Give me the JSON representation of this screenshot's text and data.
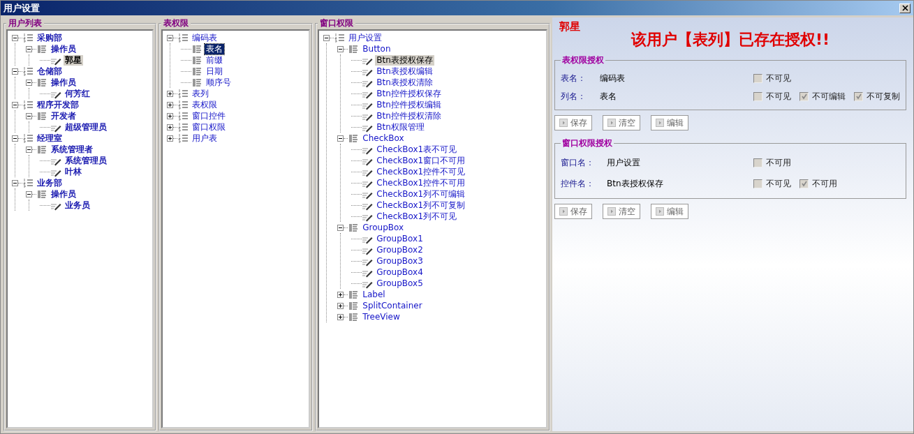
{
  "window": {
    "title": "用户设置"
  },
  "trees": [
    {
      "title": "用户列表",
      "focused": false,
      "bold": true,
      "nodes": [
        {
          "label": "采购部",
          "kind": "category",
          "expanded": true,
          "selected": false,
          "children": [
            {
              "label": "操作员",
              "kind": "list",
              "expanded": true,
              "selected": false,
              "children": [
                {
                  "label": "郭星",
                  "kind": "item",
                  "selected": true
                }
              ]
            }
          ]
        },
        {
          "label": "仓储部",
          "kind": "category",
          "expanded": true,
          "selected": false,
          "children": [
            {
              "label": "操作员",
              "kind": "list",
              "expanded": true,
              "selected": false,
              "children": [
                {
                  "label": "何芳红",
                  "kind": "item",
                  "selected": false
                }
              ]
            }
          ]
        },
        {
          "label": "程序开发部",
          "kind": "category",
          "expanded": true,
          "selected": false,
          "children": [
            {
              "label": "开发者",
              "kind": "list",
              "expanded": true,
              "selected": false,
              "children": [
                {
                  "label": "超级管理员",
                  "kind": "item",
                  "selected": false
                }
              ]
            }
          ]
        },
        {
          "label": "经理室",
          "kind": "category",
          "expanded": true,
          "selected": false,
          "children": [
            {
              "label": "系统管理者",
              "kind": "list",
              "expanded": true,
              "selected": false,
              "children": [
                {
                  "label": "系统管理员",
                  "kind": "item",
                  "selected": false
                },
                {
                  "label": "叶林",
                  "kind": "item",
                  "selected": false
                }
              ]
            }
          ]
        },
        {
          "label": "业务部",
          "kind": "category",
          "expanded": true,
          "selected": false,
          "children": [
            {
              "label": "操作员",
              "kind": "list",
              "expanded": true,
              "selected": false,
              "children": [
                {
                  "label": "业务员",
                  "kind": "item",
                  "selected": false
                }
              ]
            }
          ]
        }
      ]
    },
    {
      "title": "表权限",
      "focused": true,
      "bold": false,
      "nodes": [
        {
          "label": "编码表",
          "kind": "category",
          "expanded": true,
          "selected": false,
          "children": [
            {
              "label": "表名",
              "kind": "list",
              "selected": true
            },
            {
              "label": "前缀",
              "kind": "list",
              "selected": false
            },
            {
              "label": "日期",
              "kind": "list",
              "selected": false
            },
            {
              "label": "顺序号",
              "kind": "list",
              "selected": false
            }
          ]
        },
        {
          "label": "表列",
          "kind": "category",
          "expanded": false,
          "selected": false
        },
        {
          "label": "表权限",
          "kind": "category",
          "expanded": false,
          "selected": false
        },
        {
          "label": "窗口控件",
          "kind": "category",
          "expanded": false,
          "selected": false
        },
        {
          "label": "窗口权限",
          "kind": "category",
          "expanded": false,
          "selected": false
        },
        {
          "label": "用户表",
          "kind": "category",
          "expanded": false,
          "selected": false
        }
      ]
    },
    {
      "title": "窗口权限",
      "focused": false,
      "bold": false,
      "nodes": [
        {
          "label": "用户设置",
          "kind": "category",
          "expanded": true,
          "selected": false,
          "children": [
            {
              "label": "Button",
              "kind": "list",
              "expanded": true,
              "selected": false,
              "children": [
                {
                  "label": "Btn表授权保存",
                  "kind": "item",
                  "selected": true
                },
                {
                  "label": "Btn表授权编辑",
                  "kind": "item",
                  "selected": false
                },
                {
                  "label": "Btn表授权清除",
                  "kind": "item",
                  "selected": false
                },
                {
                  "label": "Btn控件授权保存",
                  "kind": "item",
                  "selected": false
                },
                {
                  "label": "Btn控件授权编辑",
                  "kind": "item",
                  "selected": false
                },
                {
                  "label": "Btn控件授权清除",
                  "kind": "item",
                  "selected": false
                },
                {
                  "label": "Btn权限管理",
                  "kind": "item",
                  "selected": false
                }
              ]
            },
            {
              "label": "CheckBox",
              "kind": "list",
              "expanded": true,
              "selected": false,
              "children": [
                {
                  "label": "CheckBox1表不可见",
                  "kind": "item",
                  "selected": false
                },
                {
                  "label": "CheckBox1窗口不可用",
                  "kind": "item",
                  "selected": false
                },
                {
                  "label": "CheckBox1控件不可见",
                  "kind": "item",
                  "selected": false
                },
                {
                  "label": "CheckBox1控件不可用",
                  "kind": "item",
                  "selected": false
                },
                {
                  "label": "CheckBox1列不可编辑",
                  "kind": "item",
                  "selected": false
                },
                {
                  "label": "CheckBox1列不可复制",
                  "kind": "item",
                  "selected": false
                },
                {
                  "label": "CheckBox1列不可见",
                  "kind": "item",
                  "selected": false
                }
              ]
            },
            {
              "label": "GroupBox",
              "kind": "list",
              "expanded": true,
              "selected": false,
              "children": [
                {
                  "label": "GroupBox1",
                  "kind": "item",
                  "selected": false
                },
                {
                  "label": "GroupBox2",
                  "kind": "item",
                  "selected": false
                },
                {
                  "label": "GroupBox3",
                  "kind": "item",
                  "selected": false
                },
                {
                  "label": "GroupBox4",
                  "kind": "item",
                  "selected": false
                },
                {
                  "label": "GroupBox5",
                  "kind": "item",
                  "selected": false
                }
              ]
            },
            {
              "label": "Label",
              "kind": "list",
              "expanded": false,
              "selected": false
            },
            {
              "label": "SplitContainer",
              "kind": "list",
              "expanded": false,
              "selected": false
            },
            {
              "label": "TreeView",
              "kind": "list",
              "expanded": false,
              "selected": false
            }
          ]
        }
      ]
    }
  ],
  "detail": {
    "user": "郭星",
    "message": "该用户【表列】已存在授权!!",
    "groups": [
      {
        "title": "表权限授权",
        "rows": [
          {
            "label": "表名：",
            "value": "编码表",
            "options": [
              {
                "label": "不可见",
                "checked": false
              }
            ]
          },
          {
            "label": "列名：",
            "value": "表名",
            "options": [
              {
                "label": "不可见",
                "checked": false
              },
              {
                "label": "不可编辑",
                "checked": true
              },
              {
                "label": "不可复制",
                "checked": true
              }
            ]
          }
        ],
        "buttons": [
          "保存",
          "清空",
          "编辑"
        ]
      },
      {
        "title": "窗口权限授权",
        "rows": [
          {
            "label": "窗口名：",
            "value": "用户设置",
            "options": [
              {
                "label": "不可用",
                "checked": false
              }
            ]
          },
          {
            "label": "控件名：",
            "value": "Btn表授权保存",
            "options": [
              {
                "label": "不可见",
                "checked": false
              },
              {
                "label": "不可用",
                "checked": true
              }
            ]
          }
        ],
        "buttons": [
          "保存",
          "清空",
          "编辑"
        ]
      }
    ]
  }
}
